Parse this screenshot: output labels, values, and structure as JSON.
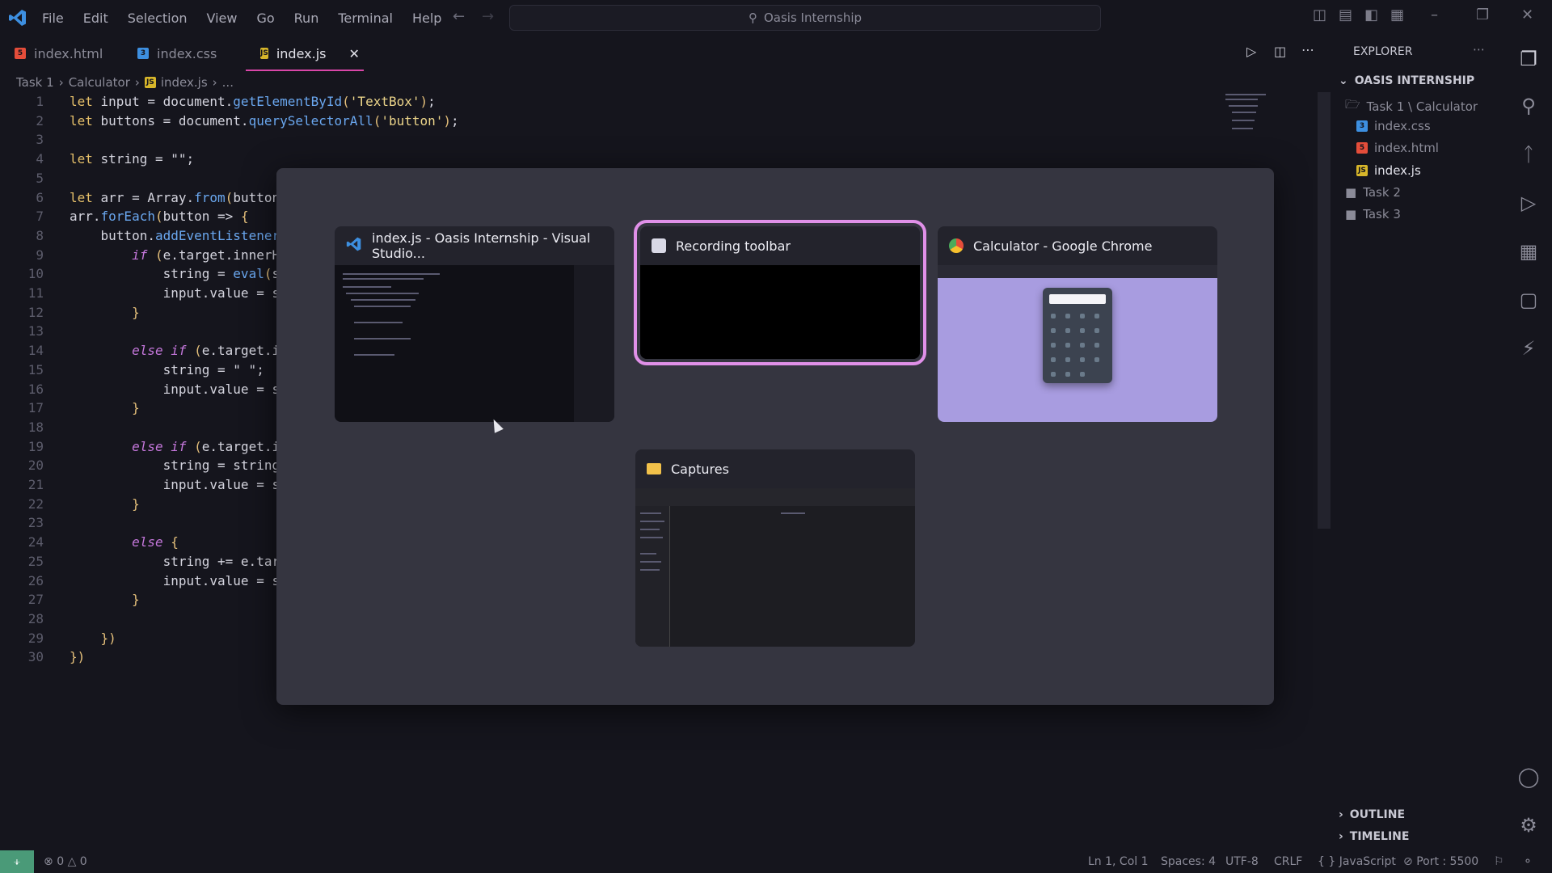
{
  "titlebar": {
    "menu": [
      "File",
      "Edit",
      "Selection",
      "View",
      "Go",
      "Run",
      "Terminal",
      "Help"
    ],
    "search_text": "Oasis Internship"
  },
  "tabs": [
    {
      "label": "index.html",
      "type": "html",
      "active": false
    },
    {
      "label": "index.css",
      "type": "css",
      "active": false
    },
    {
      "label": "index.js",
      "type": "js",
      "active": true
    }
  ],
  "breadcrumb": [
    "Task 1",
    "Calculator",
    "index.js",
    "..."
  ],
  "code_lines": [
    "let input = document.getElementById('TextBox');",
    "let buttons = document.querySelectorAll('button');",
    "",
    "let string = \"\";",
    "",
    "let arr = Array.from(button",
    "arr.forEach(button => {",
    "    button.addEventListener",
    "        if (e.target.innerH",
    "            string = eval(s",
    "            input.value = s",
    "        }",
    "",
    "        else if (e.target.i",
    "            string = \" \";",
    "            input.value = s",
    "        }",
    "",
    "        else if (e.target.i",
    "            string = string",
    "            input.value = s",
    "        }",
    "",
    "        else {",
    "            string += e.tar",
    "            input.value = s",
    "        }",
    "",
    "    })",
    "})"
  ],
  "explorer": {
    "title": "EXPLORER",
    "section": "OASIS INTERNSHIP",
    "items": [
      {
        "label": "Task 1 \\ Calculator",
        "kind": "folder-open"
      },
      {
        "label": "index.css",
        "kind": "css"
      },
      {
        "label": "index.html",
        "kind": "html"
      },
      {
        "label": "index.js",
        "kind": "js"
      },
      {
        "label": "Task 2",
        "kind": "folder"
      },
      {
        "label": "Task 3",
        "kind": "folder"
      }
    ],
    "outline": "OUTLINE",
    "timeline": "TIMELINE"
  },
  "switcher": {
    "windows": [
      {
        "title": "index.js - Oasis Internship - Visual Studio...",
        "icon": "vscode-icon"
      },
      {
        "title": "Recording toolbar",
        "icon": "recording-icon",
        "selected": true
      },
      {
        "title": "Calculator - Google Chrome",
        "icon": "chrome-icon"
      },
      {
        "title": "Captures",
        "icon": "folder-icon"
      }
    ]
  },
  "status": {
    "errors": "0",
    "warnings": "0",
    "position": "Ln 1, Col 1",
    "spaces": "Spaces: 4",
    "encoding": "UTF-8",
    "eol": "CRLF",
    "language": "JavaScript",
    "port": "Port : 5500"
  },
  "colors": {
    "accent": "#d946a8",
    "selection_outline": "#e090e8",
    "remote": "#4a9a78",
    "calculator_bg": "#a89ce0"
  }
}
